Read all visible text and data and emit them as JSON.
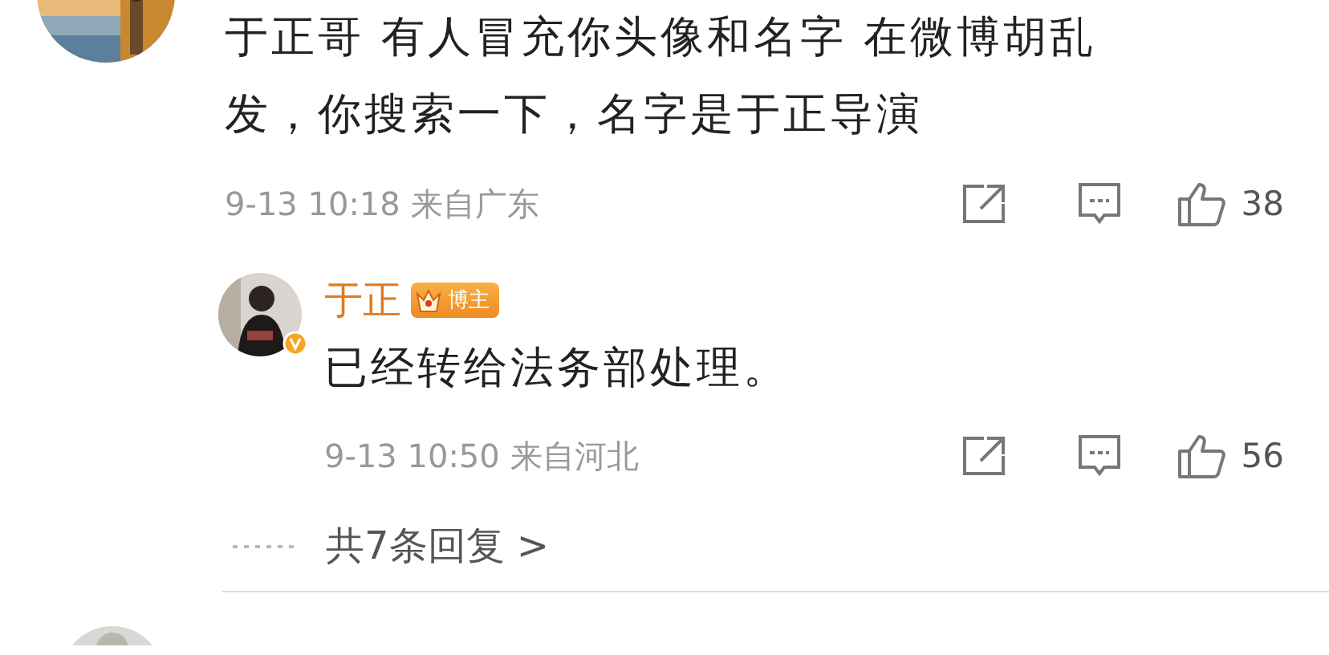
{
  "comment": {
    "text": "于正哥 有人冒充你头像和名字 在微博胡乱发，你搜索一下，名字是于正导演",
    "time": "9-13 10:18",
    "location": "来自广东",
    "likes": "38"
  },
  "reply": {
    "name": "于正",
    "badge": "博主",
    "verified": true,
    "text": "已经转给法务部处理。",
    "time": "9-13 10:50",
    "location": "来自河北",
    "likes": "56"
  },
  "more_replies": "共7条回复 >"
}
